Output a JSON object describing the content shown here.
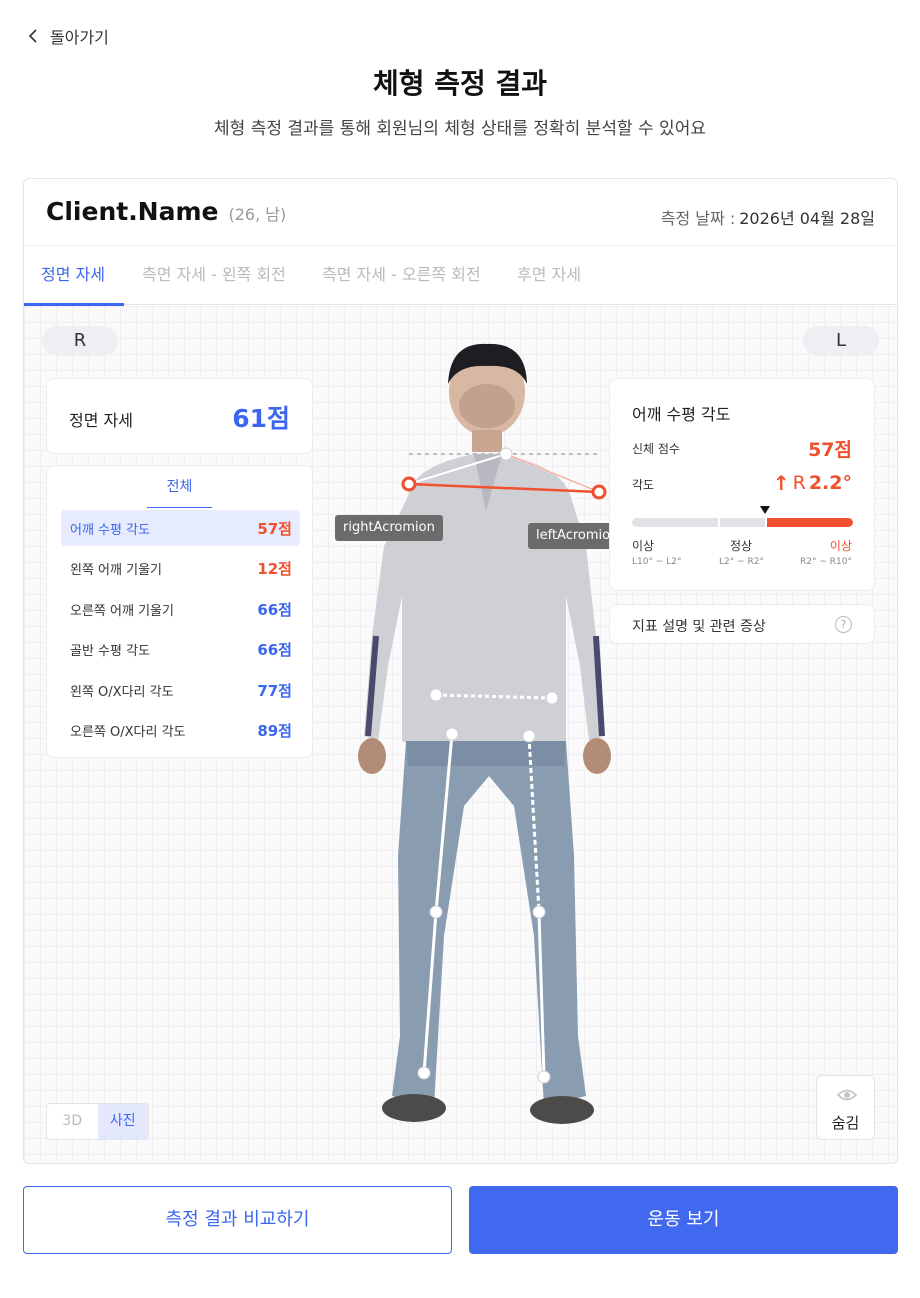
{
  "nav": {
    "back_label": "돌아가기"
  },
  "header": {
    "title": "체형 측정 결과",
    "subtitle": "체형 측정 결과를 통해 회원님의 체형 상태를 정확히 분석할 수 있어요"
  },
  "client": {
    "name": "Client.Name",
    "meta": "(26, 남)",
    "date_label": "측정 날짜 :",
    "date_value": "2026년 04월 28일"
  },
  "tabs": [
    {
      "label": "정면 자세",
      "active": true
    },
    {
      "label": "측면 자세 - 왼쪽 회전",
      "active": false
    },
    {
      "label": "측면 자세 - 오른쪽 회전",
      "active": false
    },
    {
      "label": "후면 자세",
      "active": false
    }
  ],
  "sides": {
    "right": "R",
    "left": "L"
  },
  "posture_score": {
    "label": "정면 자세",
    "value": "61점"
  },
  "metrics": {
    "tab_label": "전체",
    "items": [
      {
        "name": "어깨 수평 각도",
        "score": "57점",
        "color": "#f0502d",
        "active": true
      },
      {
        "name": "왼쪽 어깨 기울기",
        "score": "12점",
        "color": "#f0502d",
        "active": false
      },
      {
        "name": "오른쪽 어깨 기울기",
        "score": "66점",
        "color": "#3b66f0",
        "active": false
      },
      {
        "name": "골반 수평 각도",
        "score": "66점",
        "color": "#3b66f0",
        "active": false
      },
      {
        "name": "왼쪽 O/X다리 각도",
        "score": "77점",
        "color": "#3b66f0",
        "active": false
      },
      {
        "name": "오른쪽 O/X다리 각도",
        "score": "89점",
        "color": "#3b66f0",
        "active": false
      }
    ]
  },
  "detail": {
    "title": "어깨 수평 각도",
    "body_score_label": "신체 점수",
    "body_score": "57점",
    "angle_label": "각도",
    "angle_arrow": "↑",
    "angle_side": "R",
    "angle_value": "2.2°",
    "scale": [
      {
        "label": "이상",
        "range": "L10° ~ L2°",
        "color": "#333333"
      },
      {
        "label": "정상",
        "range": "L2° ~ R2°",
        "color": "#333333"
      },
      {
        "label": "이상",
        "range": "R2° ~ R10°",
        "color": "#f0502d"
      }
    ],
    "marker_fraction": 0.6
  },
  "info": {
    "label": "지표 설명 및 관련 증상",
    "help_glyph": "?"
  },
  "keypoints": {
    "right_label": "rightAcromion",
    "left_label": "leftAcromio"
  },
  "view_toggle": {
    "options": [
      "3D",
      "사진"
    ],
    "selected": "사진"
  },
  "hide_button": {
    "label": "숨김",
    "icon": "eye-icon"
  },
  "actions": {
    "compare_label": "측정 결과 비교하기",
    "exercise_label": "운동 보기"
  },
  "colors": {
    "accent": "#3b66f0",
    "alert": "#f0502d"
  }
}
